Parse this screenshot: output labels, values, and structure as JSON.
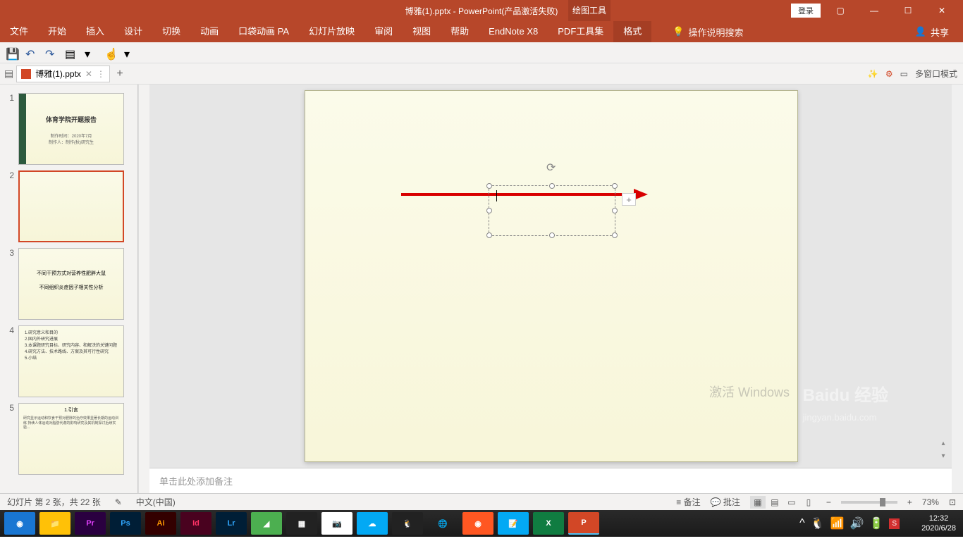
{
  "titlebar": {
    "filename": "博雅(1).pptx",
    "appname": "PowerPoint(产品激活失败)",
    "context_tab": "绘图工具",
    "login": "登录"
  },
  "ribbon": {
    "tabs": [
      "文件",
      "开始",
      "插入",
      "设计",
      "切换",
      "动画",
      "口袋动画 PA",
      "幻灯片放映",
      "审阅",
      "视图",
      "帮助",
      "EndNote X8",
      "PDF工具集",
      "格式"
    ],
    "tell_me": "操作说明搜索",
    "share": "共享"
  },
  "doctab": {
    "name": "博雅(1).pptx",
    "multi_window": "多窗口模式"
  },
  "thumbs": {
    "s1_title": "体育学院开题报告",
    "s1_sub1": "制作时间：2020年7月",
    "s1_sub2": "制作人：制作(秋)研究生",
    "s3_line1": "不同干预方式对营养性肥胖大鼠",
    "s3_line2": "不同组织炎症因子相关性分析",
    "s4_items": [
      "1.研究意义和目的",
      "2.国内外研究进展",
      "3.本课题研究目标、研究内容、和解决的关键问题",
      "4.研究方法、技术路线、方案及其可行性研究",
      "5.小结"
    ],
    "s5_title": "1.引言",
    "s5_text": "研究显示运动和饮食干预对肥胖的治疗效果显著长期的运动训练\n持续人体运动对脂肪代谢的影响研究及其机制探讨后续实验..."
  },
  "notes_placeholder": "单击此处添加备注",
  "status": {
    "slide_info": "幻灯片 第 2 张，共 22 张",
    "lang": "中文(中国)",
    "notes": "备注",
    "comments": "批注",
    "zoom": "73%"
  },
  "taskbar": {
    "time": "12:32",
    "date": "2020/6/28"
  },
  "watermark": {
    "activate": "激活 Windows",
    "baidu": "Baidu 经验",
    "url": "jingyan.baidu.com"
  }
}
